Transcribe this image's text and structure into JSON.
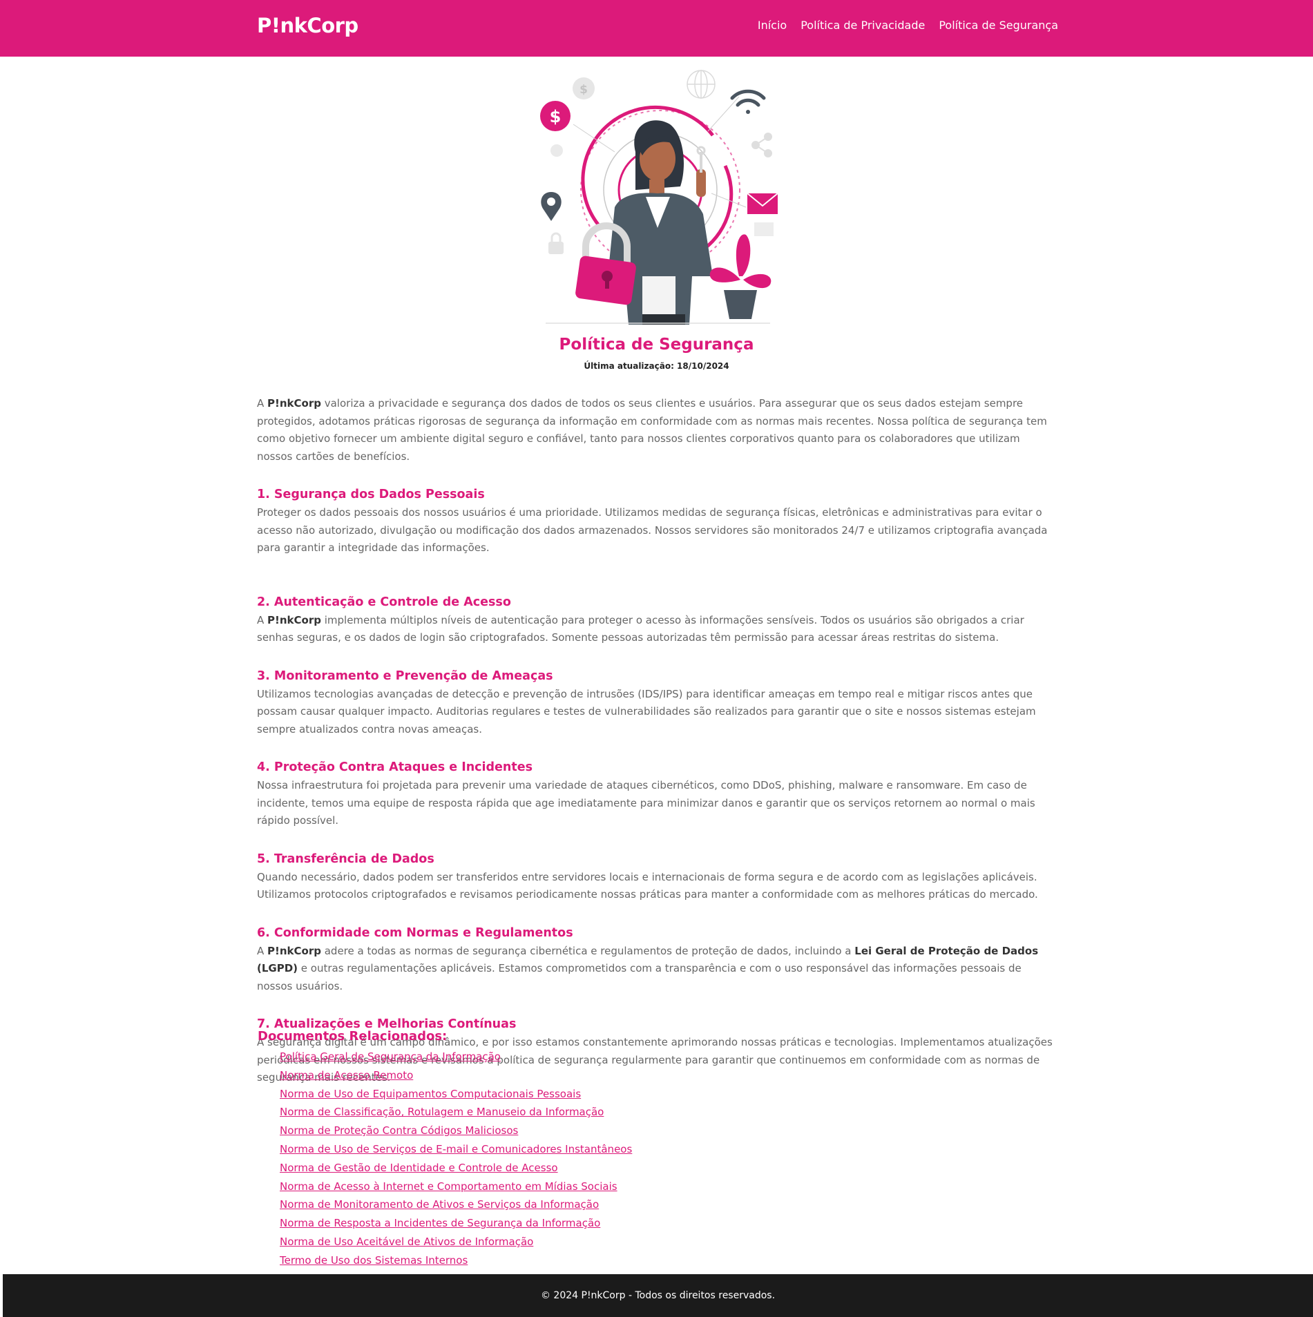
{
  "header": {
    "brand": "P!nkCorp",
    "nav": [
      "Início",
      "Política de Privacidade",
      "Política de Segurança"
    ]
  },
  "page": {
    "title": "Política de Segurança",
    "updated": "Última atualização: 18/10/2024"
  },
  "intro": {
    "pre": "A ",
    "brand": "P!nkCorp",
    "post": " valoriza a privacidade e segurança dos dados de todos os seus clientes e usuários. Para assegurar que os seus dados estejam sempre protegidos, adotamos práticas rigorosas de segurança da informação em conformidade com as normas mais recentes. Nossa política de segurança tem como objetivo fornecer um ambiente digital seguro e confiável, tanto para nossos clientes corporativos quanto para os colaboradores que utilizam nossos cartões de benefícios."
  },
  "sections": [
    {
      "title": "1. Segurança dos Dados Pessoais",
      "text": "Proteger os dados pessoais dos nossos usuários é uma prioridade. Utilizamos medidas de segurança físicas, eletrônicas e administrativas para evitar o acesso não autorizado, divulgação ou modificação dos dados armazenados. Nossos servidores são monitorados 24/7 e utilizamos criptografia avançada para garantir a integridade das informações."
    },
    {
      "title": "2. Autenticação e Controle de Acesso",
      "pre": "A ",
      "brand": "P!nkCorp",
      "text": " implementa múltiplos níveis de autenticação para proteger o acesso às informações sensíveis. Todos os usuários são obrigados a criar senhas seguras, e os dados de login são criptografados. Somente pessoas autorizadas têm permissão para acessar áreas restritas do sistema."
    },
    {
      "title": "3. Monitoramento e Prevenção de Ameaças",
      "text": "Utilizamos tecnologias avançadas de detecção e prevenção de intrusões (IDS/IPS) para identificar ameaças em tempo real e mitigar riscos antes que possam causar qualquer impacto. Auditorias regulares e testes de vulnerabilidades são realizados para garantir que o site e nossos sistemas estejam sempre atualizados contra novas ameaças."
    },
    {
      "title": "4. Proteção Contra Ataques e Incidentes",
      "text": "Nossa infraestrutura foi projetada para prevenir uma variedade de ataques cibernéticos, como DDoS, phishing, malware e ransomware. Em caso de incidente, temos uma equipe de resposta rápida que age imediatamente para minimizar danos e garantir que os serviços retornem ao normal o mais rápido possível."
    },
    {
      "title": "5. Transferência de Dados",
      "text": "Quando necessário, dados podem ser transferidos entre servidores locais e internacionais de forma segura e de acordo com as legislações aplicáveis. Utilizamos protocolos criptografados e revisamos periodicamente nossas práticas para manter a conformidade com as melhores práticas do mercado."
    },
    {
      "title": "6. Conformidade com Normas e Regulamentos",
      "pre": "A ",
      "brand": "P!nkCorp",
      "mid": " adere a todas as normas de segurança cibernética e regulamentos de proteção de dados, incluindo a ",
      "law": "Lei Geral de Proteção de Dados (LGPD)",
      "text": " e outras regulamentações aplicáveis. Estamos comprometidos com a transparência e com o uso responsável das informações pessoais de nossos usuários."
    },
    {
      "title": "7. Atualizações e Melhorias Contínuas",
      "text": "A segurança digital é um campo dinâmico, e por isso estamos constantemente aprimorando nossas práticas e tecnologias. Implementamos atualizações periódicas em nossos sistemas e revisamos a política de segurança regularmente para garantir que continuemos em conformidade com as normas de segurança mais recentes."
    }
  ],
  "documents": {
    "title": "Documentos Relacionados:",
    "items": [
      "Política Geral de Segurança da Informação",
      "Norma de Acesso Remoto",
      "Norma de Uso de Equipamentos Computacionais Pessoais",
      "Norma de Classificação, Rotulagem e Manuseio da Informação",
      "Norma de Proteção Contra Códigos Maliciosos",
      "Norma de Uso de Serviços de E-mail e Comunicadores Instantâneos",
      "Norma de Gestão de Identidade e Controle de Acesso",
      "Norma de Acesso à Internet e Comportamento em Mídias Sociais",
      "Norma de Monitoramento de Ativos e Serviços da Informação",
      "Norma de Resposta a Incidentes de Segurança da Informação",
      "Norma de Uso Aceitável de Ativos de Informação",
      "Termo de Uso dos Sistemas Internos"
    ]
  },
  "footer": {
    "text": "© 2024 P!nkCorp - Todos os direitos reservados."
  },
  "colors": {
    "brand": "#dc1a7a",
    "footer_bg": "#1b1b1b",
    "text": "#666666"
  },
  "hero": {
    "icons": [
      "dollar-coin-icon",
      "globe-icon",
      "wifi-icon",
      "share-icon",
      "location-pin-icon",
      "padlock-icon",
      "envelope-icon",
      "key-icon",
      "plant-icon"
    ]
  }
}
